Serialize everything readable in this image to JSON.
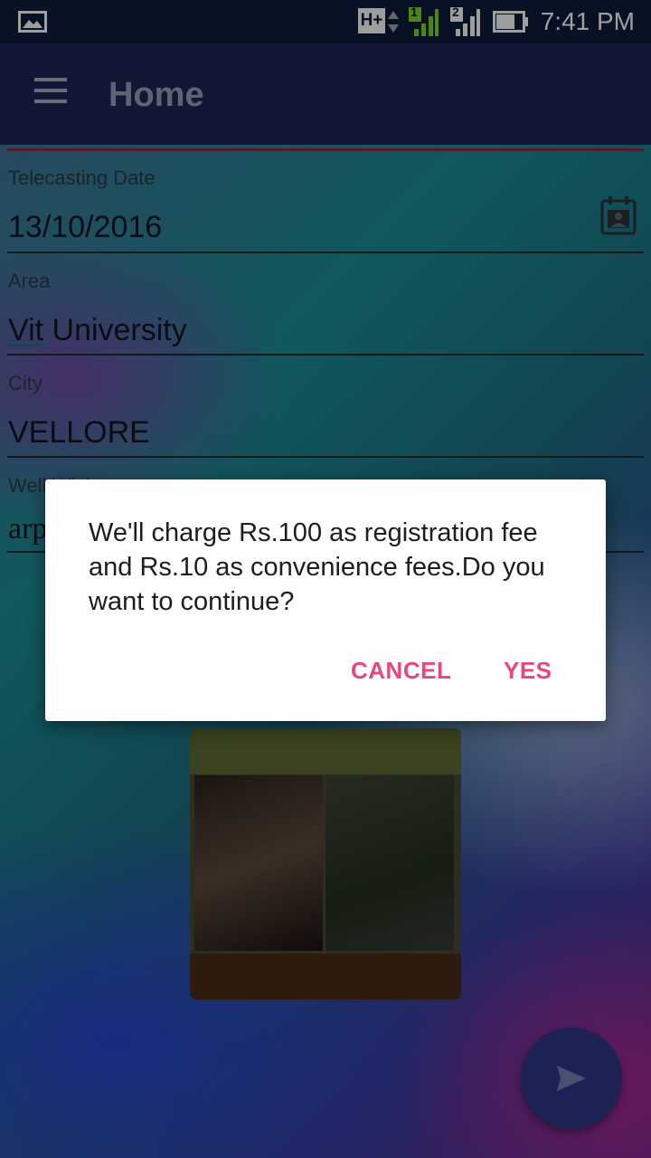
{
  "status_bar": {
    "time": "7:41 PM",
    "icons": [
      "image-notification-icon",
      "hplus-data-icon",
      "signal-sim1-icon",
      "signal-sim2-icon",
      "battery-icon"
    ],
    "sim1_label": "1",
    "sim2_label": "2",
    "network_label": "H+"
  },
  "toolbar": {
    "title": "Home",
    "menu_icon": "hamburger-menu-icon"
  },
  "form": {
    "telecasting_date": {
      "label": "Telecasting Date",
      "value": "13/10/2016"
    },
    "area": {
      "label": "Area",
      "value": "Vit University"
    },
    "city": {
      "label": "City",
      "value": "VELLORE"
    },
    "well_wisher": {
      "label": "Well Wishers",
      "value": "arp"
    }
  },
  "dialog": {
    "message": "We'll charge Rs.100 as registration fee and Rs.10 as convenience fees.Do you want to continue?",
    "cancel_label": "CANCEL",
    "yes_label": "YES"
  },
  "photo": {
    "icon": "collage-photo"
  },
  "fab": {
    "icon": "send-icon"
  },
  "colors": {
    "status_bar": "#0e1a3a",
    "toolbar": "#1d2657",
    "dialog_button": "#e8467c",
    "fab": "#1c2354"
  }
}
